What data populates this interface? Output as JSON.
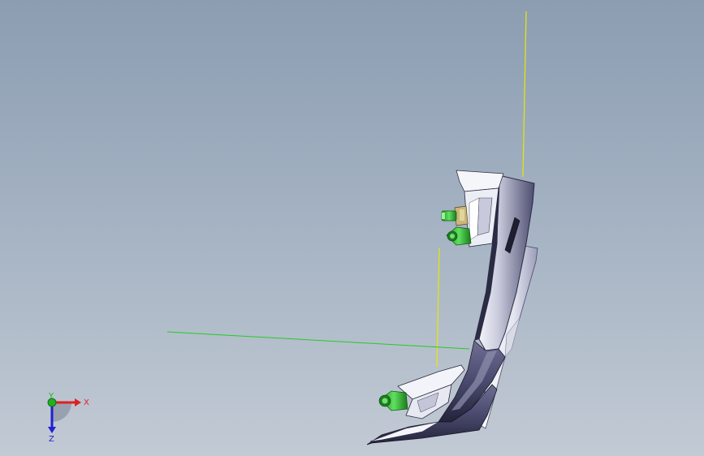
{
  "viewport": {
    "background_top": "#8c9db2",
    "background_bottom": "#c2cad4"
  },
  "reference_lines": {
    "yellow_color": "#e8e800",
    "green_color": "#22cc22"
  },
  "part": {
    "body_color": "#4a4a70",
    "highlight_color": "#e6e8f2",
    "clip_color": "#2ec42e"
  },
  "triad": {
    "x_label": "X",
    "y_label": "Y",
    "z_label": "Z",
    "x_color": "#e02020",
    "y_color": "#20b020",
    "z_color": "#2020d0"
  }
}
